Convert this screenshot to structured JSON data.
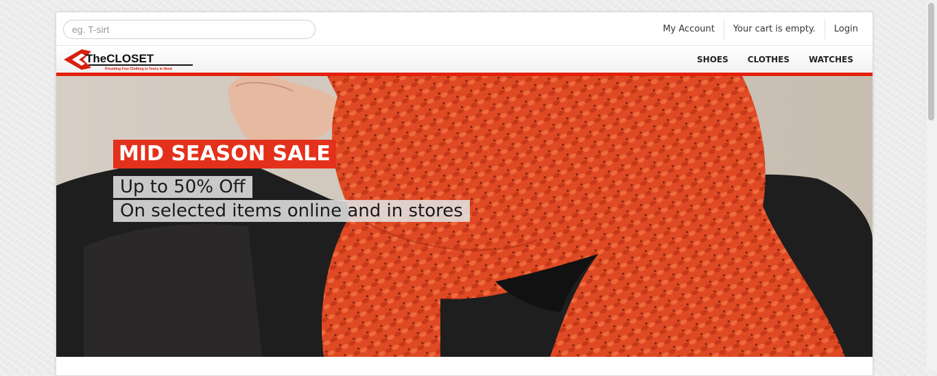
{
  "search": {
    "placeholder": "eg. T-sirt",
    "value": ""
  },
  "account_links": [
    "My Account",
    "Your cart is empty.",
    "Login"
  ],
  "logo": {
    "name": "TheCLOSET",
    "tagline": "Providing Free Clothing to Teens in Need"
  },
  "nav": [
    "SHOES",
    "CLOTHES",
    "WATCHES"
  ],
  "hero": {
    "title": "MID SEASON SALE",
    "line1": "Up to 50% Off",
    "line2": "On selected items online and in stores"
  },
  "colors": {
    "accent": "#e3200d",
    "scarf": "#e4522b",
    "sweater": "#1f1e1e"
  }
}
